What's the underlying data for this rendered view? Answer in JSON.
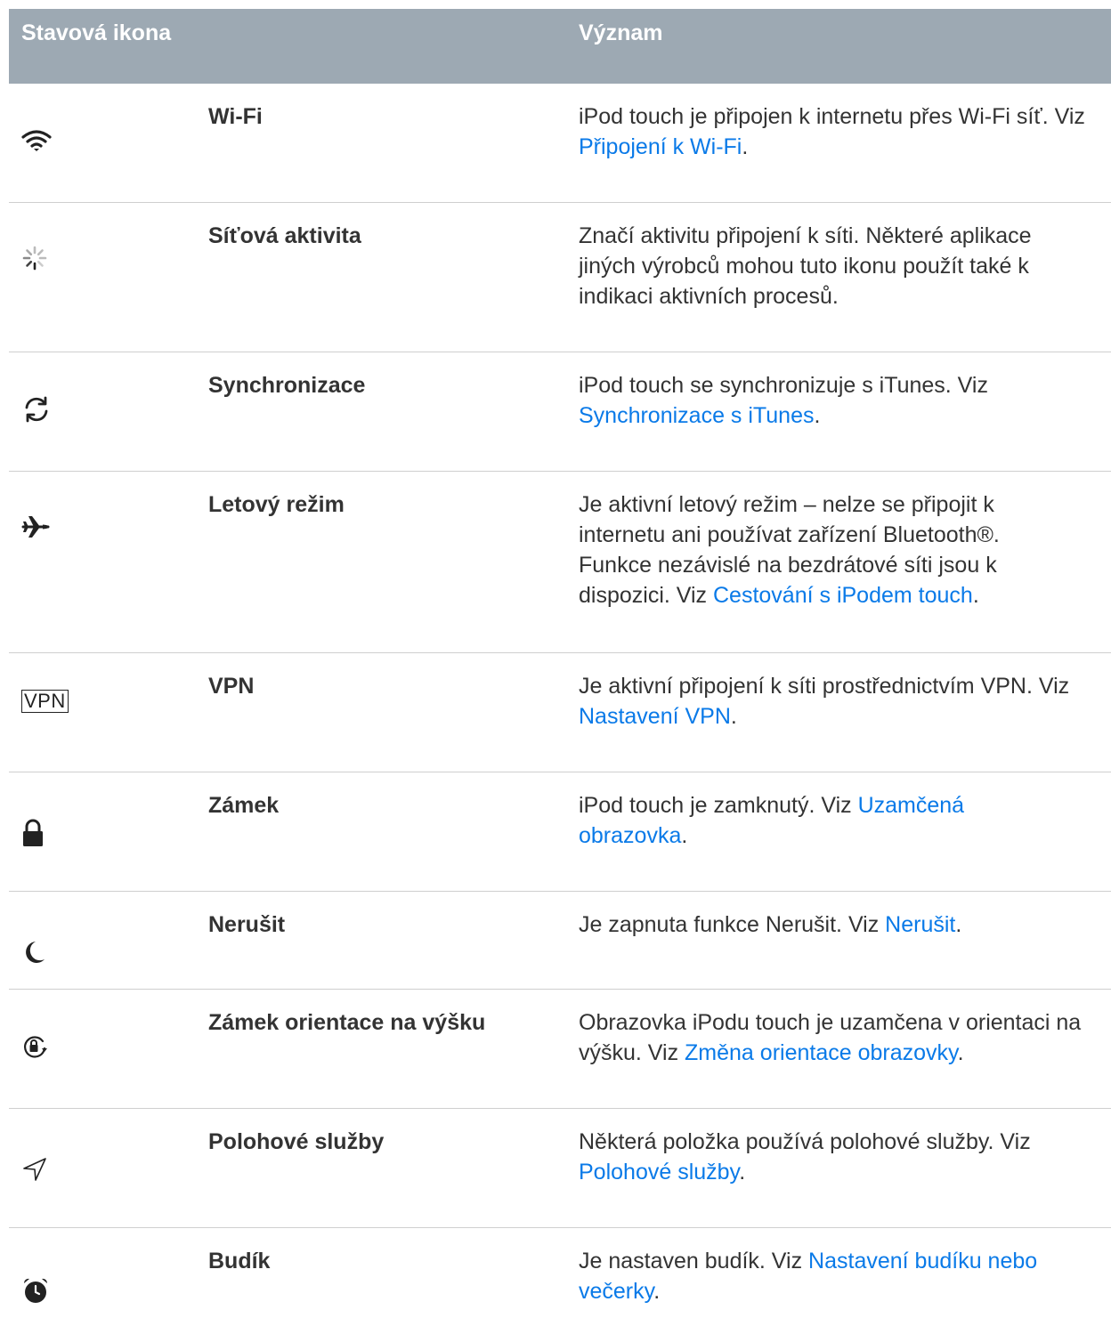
{
  "header": {
    "icon_col": "Stavová ikona",
    "meaning_col": "Význam"
  },
  "rows": [
    {
      "icon": "wifi-icon",
      "name": "Wi-Fi",
      "desc_pre": "iPod touch je připojen k internetu přes Wi-Fi síť. Viz ",
      "link": "Připojení k Wi-Fi",
      "desc_post": "."
    },
    {
      "icon": "network-activity-icon",
      "name": "Síťová aktivita",
      "desc_pre": "Značí aktivitu připojení k síti. Některé aplikace jiných výrobců mohou tuto ikonu použít také k indikaci aktivních procesů.",
      "link": "",
      "desc_post": ""
    },
    {
      "icon": "sync-icon",
      "name": "Synchronizace",
      "desc_pre": "iPod touch se synchronizuje s iTunes. Viz ",
      "link": "Synchronizace s iTunes",
      "desc_post": "."
    },
    {
      "icon": "airplane-icon",
      "name": "Letový režim",
      "desc_pre": "Je aktivní letový režim – nelze se připojit k internetu ani používat zařízení Bluetooth®. Funkce nezávislé na bezdrátové síti jsou k dispozici. Viz ",
      "link": "Cestování s iPodem touch",
      "desc_post": "."
    },
    {
      "icon": "vpn-icon",
      "icon_text": "VPN",
      "name": "VPN",
      "desc_pre": "Je aktivní připojení k síti prostřednictvím VPN. Viz ",
      "link": "Nastavení VPN",
      "desc_post": "."
    },
    {
      "icon": "lock-icon",
      "name": "Zámek",
      "desc_pre": "iPod touch je zamknutý. Viz ",
      "link": "Uzamčená obrazovka",
      "desc_post": "."
    },
    {
      "icon": "moon-icon",
      "name": "Nerušit",
      "desc_pre": "Je zapnuta funkce Nerušit. Viz ",
      "link": "Nerušit",
      "desc_post": "."
    },
    {
      "icon": "orientation-lock-icon",
      "name": "Zámek orientace na výšku",
      "desc_pre": "Obrazovka iPodu touch je uzamčena v orientaci na výšku. Viz ",
      "link": "Změna orientace obrazovky",
      "desc_post": "."
    },
    {
      "icon": "location-arrow-icon",
      "name": "Polohové služby",
      "desc_pre": "Některá položka používá polohové služby. Viz ",
      "link": "Polohové služby",
      "desc_post": "."
    },
    {
      "icon": "alarm-clock-icon",
      "name": "Budík",
      "desc_pre": "Je nastaven budík. Viz ",
      "link": "Nastavení budíku nebo večerky",
      "desc_post": "."
    }
  ]
}
